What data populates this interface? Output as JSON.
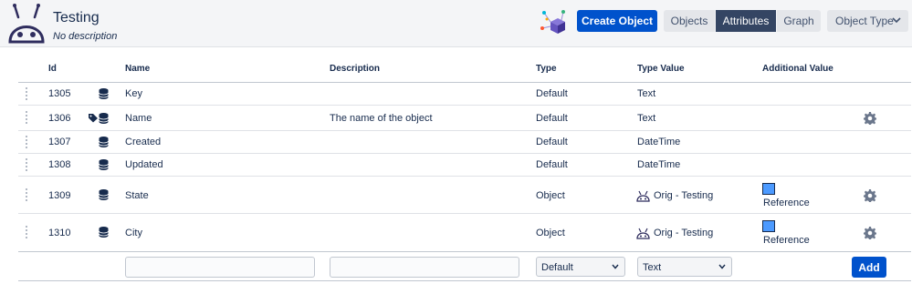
{
  "header": {
    "title": "Testing",
    "subtitle": "No description",
    "create_label": "Create Object",
    "tabs": [
      "Objects",
      "Attributes",
      "Graph"
    ],
    "object_type_label": "Object Type"
  },
  "columns": [
    "Id",
    "Name",
    "Description",
    "Type",
    "Type Value",
    "Additional Value"
  ],
  "rows": [
    {
      "id": "1305",
      "name": "Key",
      "description": "",
      "type": "Default",
      "type_value": "Text",
      "additional": "",
      "gear": false,
      "tag": false
    },
    {
      "id": "1306",
      "name": "Name",
      "description": "The name of the object",
      "type": "Default",
      "type_value": "Text",
      "additional": "",
      "gear": true,
      "tag": true
    },
    {
      "id": "1307",
      "name": "Created",
      "description": "",
      "type": "Default",
      "type_value": "DateTime",
      "additional": "",
      "gear": false,
      "tag": false
    },
    {
      "id": "1308",
      "name": "Updated",
      "description": "",
      "type": "Default",
      "type_value": "DateTime",
      "additional": "",
      "gear": false,
      "tag": false
    },
    {
      "id": "1309",
      "name": "State",
      "description": "",
      "type": "Object",
      "type_value": "Orig - Testing",
      "additional": "Reference",
      "gear": true,
      "tag": false
    },
    {
      "id": "1310",
      "name": "City",
      "description": "",
      "type": "Object",
      "type_value": "Orig - Testing",
      "additional": "Reference",
      "gear": true,
      "tag": false
    }
  ],
  "add_row": {
    "name_value": "",
    "description_value": "",
    "type_selected": "Default",
    "type_value_selected": "Text",
    "add_label": "Add"
  },
  "colors": {
    "primary": "#0052cc",
    "active_tab": "#344563",
    "reference": "#4c9aff"
  }
}
